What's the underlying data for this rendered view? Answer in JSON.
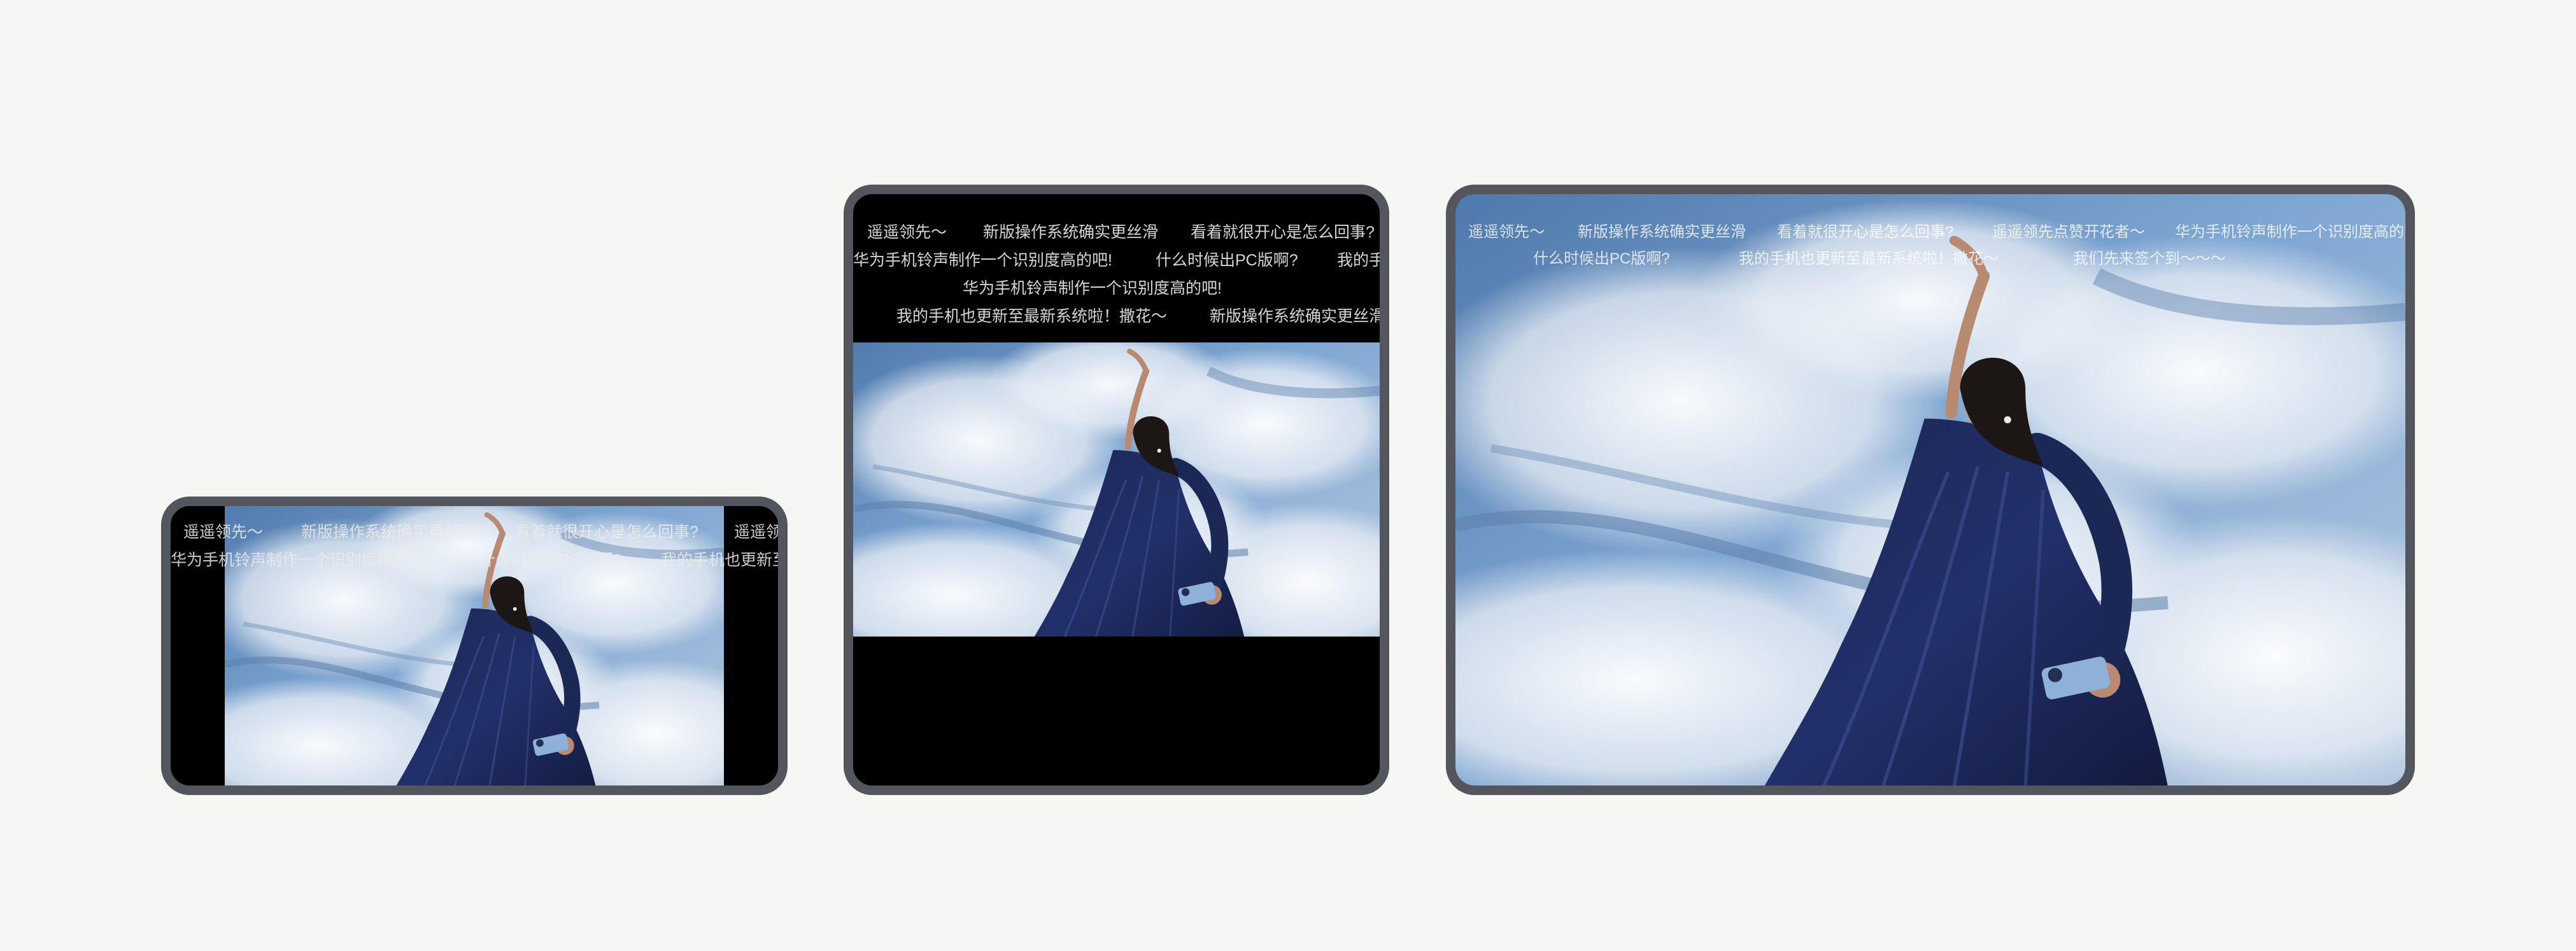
{
  "devices": {
    "phone": {
      "danmaku": [
        "遥遥领先～",
        "新版操作系统确实更丝滑",
        "看着就很开心是怎么回事?",
        "遥遥领",
        "华为手机铃声制作一个识别度高的吧!",
        "什么时候出PC版啊?",
        "我的手机也更新至"
      ]
    },
    "foldable": {
      "danmaku": [
        "遥遥领先～",
        "新版操作系统确实更丝滑",
        "看着就很开心是怎么回事?",
        "华为手机铃声制作一个识别度高的吧!",
        "什么时候出PC版啊?",
        "我的手",
        "华为手机铃声制作一个识别度高的吧!",
        "我的手机也更新至最新系统啦！撒花～",
        "新版操作系统确实更丝滑"
      ]
    },
    "tablet": {
      "danmaku": [
        "遥遥领先～",
        "新版操作系统确实更丝滑",
        "看着就很开心是怎么回事?",
        "遥遥领先点赞开花者～",
        "华为手机铃声制作一个识别度高的吧",
        "什么时候出PC版啊?",
        "我的手机也更新至最新系统啦！撒花～",
        "我们先来签个到～～～"
      ]
    }
  },
  "colors": {
    "frame": "#53565c",
    "background": "#f6f6f4",
    "letterbox": "#000000"
  }
}
